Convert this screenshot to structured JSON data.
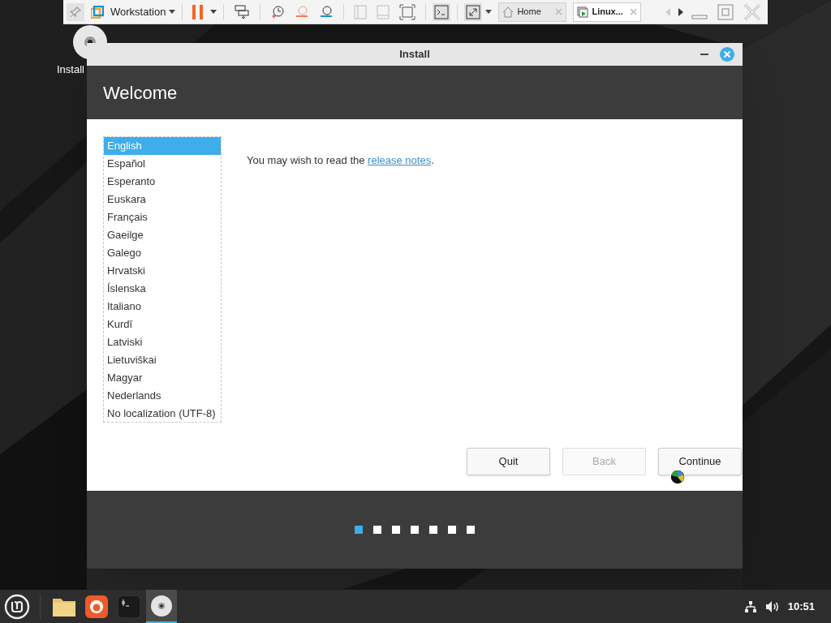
{
  "vm_toolbar": {
    "product": "Workstation",
    "tabs": [
      {
        "label": "Home",
        "selected": false
      },
      {
        "label": "Linux...",
        "selected": true
      }
    ]
  },
  "desktop_icons": [
    {
      "label": "Install"
    }
  ],
  "window": {
    "title": "Install"
  },
  "header": {
    "title": "Welcome"
  },
  "languages": [
    {
      "label": "English",
      "selected": true
    },
    {
      "label": "Español",
      "selected": false
    },
    {
      "label": "Esperanto",
      "selected": false
    },
    {
      "label": "Euskara",
      "selected": false
    },
    {
      "label": "Français",
      "selected": false
    },
    {
      "label": "Gaeilge",
      "selected": false
    },
    {
      "label": "Galego",
      "selected": false
    },
    {
      "label": "Hrvatski",
      "selected": false
    },
    {
      "label": "Íslenska",
      "selected": false
    },
    {
      "label": "Italiano",
      "selected": false
    },
    {
      "label": "Kurdî",
      "selected": false
    },
    {
      "label": "Latviski",
      "selected": false
    },
    {
      "label": "Lietuviškai",
      "selected": false
    },
    {
      "label": "Magyar",
      "selected": false
    },
    {
      "label": "Nederlands",
      "selected": false
    },
    {
      "label": "No localization (UTF-8)",
      "selected": false
    }
  ],
  "notes": {
    "before": "You may wish to read the ",
    "link": "release notes",
    "after": "."
  },
  "buttons": [
    {
      "label": "Quit",
      "disabled": false
    },
    {
      "label": "Back",
      "disabled": true
    },
    {
      "label": "Continue",
      "disabled": false
    }
  ],
  "steps": [
    {
      "selected": true
    },
    {
      "selected": false
    },
    {
      "selected": false
    },
    {
      "selected": false
    },
    {
      "selected": false
    },
    {
      "selected": false
    },
    {
      "selected": false
    }
  ],
  "taskbar": {
    "apps": [
      {
        "kind": "files",
        "selected": false
      },
      {
        "kind": "browser",
        "selected": false
      },
      {
        "kind": "terminal",
        "selected": false
      },
      {
        "kind": "disc",
        "selected": true
      }
    ],
    "clock": "10:51"
  }
}
